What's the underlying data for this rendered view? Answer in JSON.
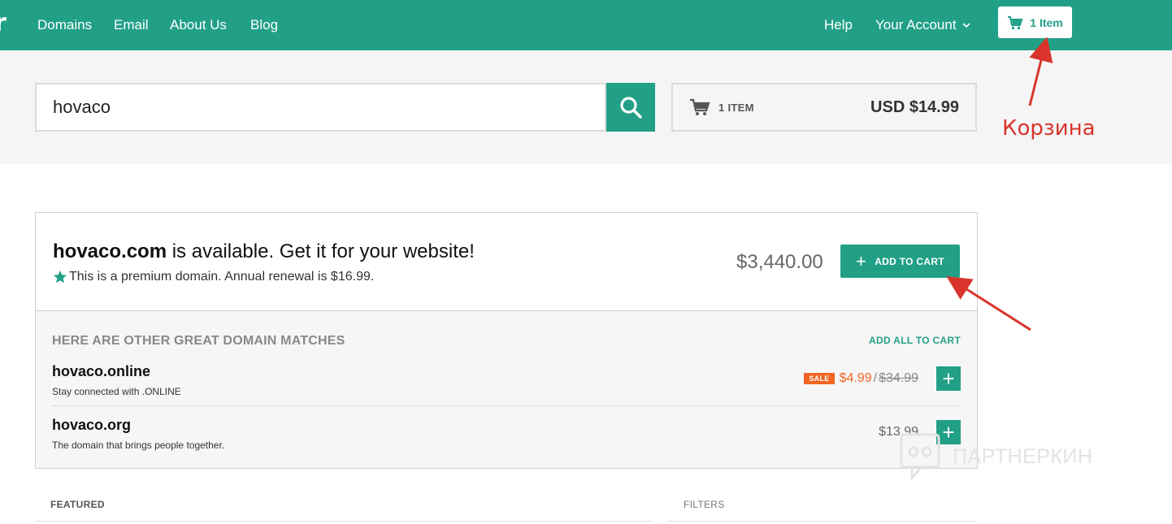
{
  "nav": {
    "logo_fragment": "r",
    "links": [
      "Domains",
      "Email",
      "About Us",
      "Blog"
    ],
    "help": "Help",
    "account": "Your Account",
    "cart_button": "1 Item"
  },
  "search": {
    "value": "hovaco",
    "placeholder": ""
  },
  "cart_summary": {
    "items": "1 ITEM",
    "total": "USD $14.99"
  },
  "annotation": {
    "label": "Корзина",
    "color": "#d9342b"
  },
  "main_result": {
    "domain": "hovaco.com",
    "title_rest": " is available. Get it for your website!",
    "subtitle": "This is a premium domain. Annual renewal is $16.99.",
    "price": "$3,440.00",
    "add_label": "ADD TO CART"
  },
  "matches": {
    "heading": "HERE ARE OTHER GREAT DOMAIN MATCHES",
    "add_all": "ADD ALL TO CART",
    "rows": [
      {
        "name": "hovaco.online",
        "desc": "Stay connected with .ONLINE",
        "badge": "SALE",
        "price": "$4.99",
        "slash": "/",
        "old_price": "$34.99"
      },
      {
        "name": "hovaco.org",
        "desc": "The domain that brings people together.",
        "price": "$13.99"
      }
    ]
  },
  "watermark": "ПАРТНЕРКИН",
  "sections": {
    "featured": "FEATURED",
    "filters": "FILTERS"
  },
  "colors": {
    "brand": "#22a087",
    "sale": "#f26522"
  }
}
